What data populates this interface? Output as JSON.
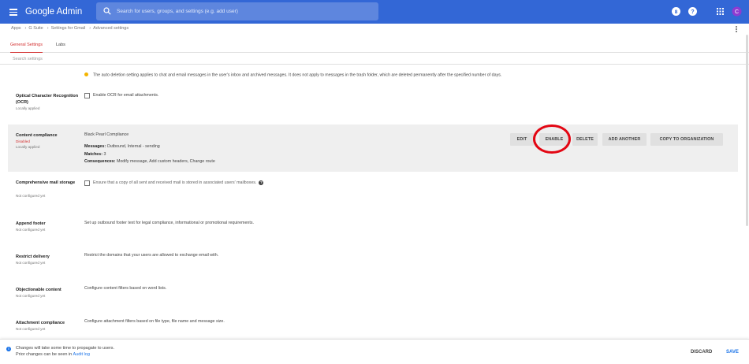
{
  "app": {
    "title": "Google Admin"
  },
  "search": {
    "placeholder": "Search for users, groups, and settings (e.g. add user)"
  },
  "header": {
    "avatar_letter": "C",
    "help_glyph": "?"
  },
  "breadcrumb": [
    "Apps",
    "G Suite",
    "Settings for Gmail",
    "Advanced settings"
  ],
  "tabs": [
    {
      "label": "General Settings",
      "active": true
    },
    {
      "label": "Labs",
      "active": false
    }
  ],
  "search_settings": {
    "placeholder": "Search settings"
  },
  "info_note": "The auto deletion setting applies to chat and email messages in the user's inbox and archived messages. It does not apply to messages in the trash folder, which are deleted permanently after the specified number of days.",
  "settings": {
    "ocr": {
      "title": "Optical Character Recognition (OCR)",
      "status": "Locally applied",
      "checkbox_label": "Enable OCR for email attachments."
    },
    "content_compliance": {
      "title": "Content compliance",
      "status1": "Disabled",
      "status2": "Locally applied",
      "rule_name": "Black Pearl Compliance",
      "messages_label": "Messages:",
      "messages_value": "Outbound, Internal - sending",
      "matches_label": "Matches:",
      "matches_value": "3",
      "consequences_label": "Consequences:",
      "consequences_value": "Modify message, Add custom headers, Change route",
      "buttons": {
        "edit": "EDIT",
        "enable": "ENABLE",
        "delete": "DELETE",
        "add_another": "ADD ANOTHER",
        "copy_to_org": "COPY TO ORGANIZATION"
      }
    },
    "mail_storage": {
      "title": "Comprehensive mail storage",
      "status": "Not configured yet",
      "checkbox_label": "Ensure that a copy of all sent and received mail is stored in associated users' mailboxes."
    },
    "append_footer": {
      "title": "Append footer",
      "status": "Not configured yet",
      "description": "Set up outbound footer text for legal compliance, informational or promotional requirements."
    },
    "restrict_delivery": {
      "title": "Restrict delivery",
      "status": "Not configured yet",
      "description": "Restrict the domains that your users are allowed to exchange email with."
    },
    "objectionable_content": {
      "title": "Objectionable content",
      "status": "Not configured yet",
      "description": "Configure content filters based on word lists."
    },
    "attachment_compliance": {
      "title": "Attachment compliance",
      "status": "Not configured yet",
      "description": "Configure attachment filters based on file type, file name and message size."
    }
  },
  "bottom": {
    "line1": "Changes will take some time to propagate to users.",
    "line2_prefix": "Prior changes can be seen in",
    "audit_link": "Audit log",
    "discard": "DISCARD",
    "save": "SAVE"
  },
  "icons": {
    "menu": "hamburger-icon",
    "search": "search-icon",
    "counter": "counter-icon",
    "help": "help-icon",
    "apps": "apps-grid-icon",
    "more": "more-vert-icon",
    "warning": "warning-icon",
    "info": "info-icon"
  },
  "colors": {
    "brand_bar": "#3367d6",
    "accent_red": "#d32f2f",
    "highlight_row": "#efefef",
    "annotation_circle": "#e30613",
    "link_blue": "#1a73e8",
    "avatar": "#8e3bd1"
  }
}
